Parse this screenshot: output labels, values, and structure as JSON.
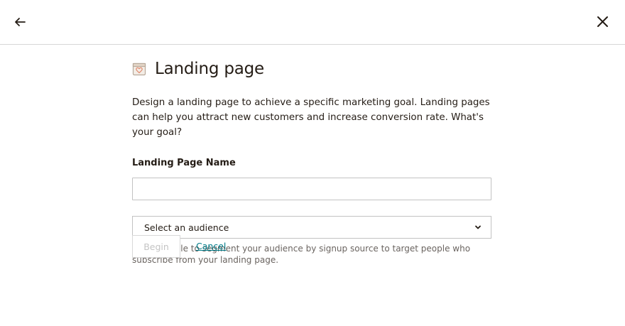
{
  "header": {
    "back_icon": "arrow-left-icon",
    "close_icon": "close-icon"
  },
  "main": {
    "icon": "landing-page-icon",
    "title": "Landing page",
    "description": "Design a landing page to achieve a specific marketing goal. Landing pages can help you attract new customers and increase conversion rate. What's your goal?",
    "name_field": {
      "label": "Landing Page Name",
      "value": "",
      "placeholder": ""
    },
    "audience_select": {
      "selected": "Select an audience",
      "help_text": "You'll be able to segment your audience by signup source to target people who subscribe from your landing page."
    },
    "actions": {
      "begin_label": "Begin",
      "cancel_label": "Cancel"
    }
  },
  "colors": {
    "text": "#241c15",
    "link": "#007c89",
    "disabled_text": "#c4c4c4",
    "border": "#c2c2c2"
  }
}
